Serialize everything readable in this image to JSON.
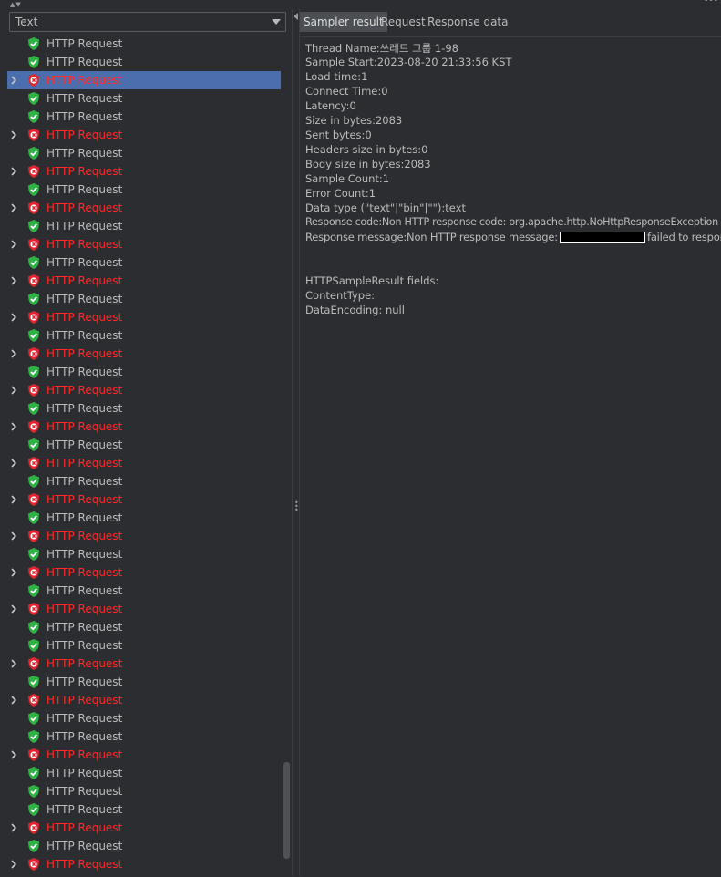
{
  "left_panel": {
    "renderer_select": {
      "value": "Text"
    },
    "items": [
      {
        "label": "HTTP Request",
        "status": "success",
        "expandable": false,
        "selected": false
      },
      {
        "label": "HTTP Request",
        "status": "success",
        "expandable": false,
        "selected": false
      },
      {
        "label": "HTTP Request",
        "status": "error",
        "expandable": true,
        "selected": true
      },
      {
        "label": "HTTP Request",
        "status": "success",
        "expandable": false,
        "selected": false
      },
      {
        "label": "HTTP Request",
        "status": "success",
        "expandable": false,
        "selected": false
      },
      {
        "label": "HTTP Request",
        "status": "error",
        "expandable": true,
        "selected": false
      },
      {
        "label": "HTTP Request",
        "status": "success",
        "expandable": false,
        "selected": false
      },
      {
        "label": "HTTP Request",
        "status": "error",
        "expandable": true,
        "selected": false
      },
      {
        "label": "HTTP Request",
        "status": "success",
        "expandable": false,
        "selected": false
      },
      {
        "label": "HTTP Request",
        "status": "error",
        "expandable": true,
        "selected": false
      },
      {
        "label": "HTTP Request",
        "status": "success",
        "expandable": false,
        "selected": false
      },
      {
        "label": "HTTP Request",
        "status": "error",
        "expandable": true,
        "selected": false
      },
      {
        "label": "HTTP Request",
        "status": "success",
        "expandable": false,
        "selected": false
      },
      {
        "label": "HTTP Request",
        "status": "error",
        "expandable": true,
        "selected": false
      },
      {
        "label": "HTTP Request",
        "status": "success",
        "expandable": false,
        "selected": false
      },
      {
        "label": "HTTP Request",
        "status": "error",
        "expandable": true,
        "selected": false
      },
      {
        "label": "HTTP Request",
        "status": "success",
        "expandable": false,
        "selected": false
      },
      {
        "label": "HTTP Request",
        "status": "error",
        "expandable": true,
        "selected": false
      },
      {
        "label": "HTTP Request",
        "status": "success",
        "expandable": false,
        "selected": false
      },
      {
        "label": "HTTP Request",
        "status": "error",
        "expandable": true,
        "selected": false
      },
      {
        "label": "HTTP Request",
        "status": "success",
        "expandable": false,
        "selected": false
      },
      {
        "label": "HTTP Request",
        "status": "error",
        "expandable": true,
        "selected": false
      },
      {
        "label": "HTTP Request",
        "status": "success",
        "expandable": false,
        "selected": false
      },
      {
        "label": "HTTP Request",
        "status": "error",
        "expandable": true,
        "selected": false
      },
      {
        "label": "HTTP Request",
        "status": "success",
        "expandable": false,
        "selected": false
      },
      {
        "label": "HTTP Request",
        "status": "error",
        "expandable": true,
        "selected": false
      },
      {
        "label": "HTTP Request",
        "status": "success",
        "expandable": false,
        "selected": false
      },
      {
        "label": "HTTP Request",
        "status": "error",
        "expandable": true,
        "selected": false
      },
      {
        "label": "HTTP Request",
        "status": "success",
        "expandable": false,
        "selected": false
      },
      {
        "label": "HTTP Request",
        "status": "error",
        "expandable": true,
        "selected": false
      },
      {
        "label": "HTTP Request",
        "status": "success",
        "expandable": false,
        "selected": false
      },
      {
        "label": "HTTP Request",
        "status": "error",
        "expandable": true,
        "selected": false
      },
      {
        "label": "HTTP Request",
        "status": "success",
        "expandable": false,
        "selected": false
      },
      {
        "label": "HTTP Request",
        "status": "success",
        "expandable": false,
        "selected": false
      },
      {
        "label": "HTTP Request",
        "status": "error",
        "expandable": true,
        "selected": false
      },
      {
        "label": "HTTP Request",
        "status": "success",
        "expandable": false,
        "selected": false
      },
      {
        "label": "HTTP Request",
        "status": "error",
        "expandable": true,
        "selected": false
      },
      {
        "label": "HTTP Request",
        "status": "success",
        "expandable": false,
        "selected": false
      },
      {
        "label": "HTTP Request",
        "status": "success",
        "expandable": false,
        "selected": false
      },
      {
        "label": "HTTP Request",
        "status": "error",
        "expandable": true,
        "selected": false
      },
      {
        "label": "HTTP Request",
        "status": "success",
        "expandable": false,
        "selected": false
      },
      {
        "label": "HTTP Request",
        "status": "success",
        "expandable": false,
        "selected": false
      },
      {
        "label": "HTTP Request",
        "status": "success",
        "expandable": false,
        "selected": false
      },
      {
        "label": "HTTP Request",
        "status": "error",
        "expandable": true,
        "selected": false
      },
      {
        "label": "HTTP Request",
        "status": "success",
        "expandable": false,
        "selected": false
      },
      {
        "label": "HTTP Request",
        "status": "error",
        "expandable": true,
        "selected": false
      }
    ]
  },
  "right_panel": {
    "tabs": [
      {
        "label": "Sampler result",
        "active": true
      },
      {
        "label": "Request",
        "active": false
      },
      {
        "label": "Response data",
        "active": false
      }
    ],
    "sampler_result": {
      "thread_name": "Thread Name:쓰레드 그룹 1-98",
      "sample_start": "Sample Start:2023-08-20 21:33:56 KST",
      "load_time": "Load time:1",
      "connect_time": "Connect Time:0",
      "latency": "Latency:0",
      "size_in_bytes": "Size in bytes:2083",
      "sent_bytes": "Sent bytes:0",
      "headers_size": "Headers size in bytes:0",
      "body_size": "Body size in bytes:2083",
      "sample_count": "Sample Count:1",
      "error_count": "Error Count:1",
      "data_type": "Data type (\"text\"|\"bin\"|\"\"):text",
      "response_code": "Response code:Non HTTP response code: org.apache.http.NoHttpResponseException",
      "response_message_prefix": "Response message:Non HTTP response message:",
      "response_message_suffix": "failed to respond",
      "fields_header": "HTTPSampleResult fields:",
      "content_type": "ContentType:",
      "data_encoding": "DataEncoding: null"
    }
  },
  "colors": {
    "background": "#2b2d30",
    "selection": "#4b6eaf",
    "error_text": "#ff2a2a",
    "success_icon": "#2fb344",
    "error_icon": "#e0262e"
  }
}
